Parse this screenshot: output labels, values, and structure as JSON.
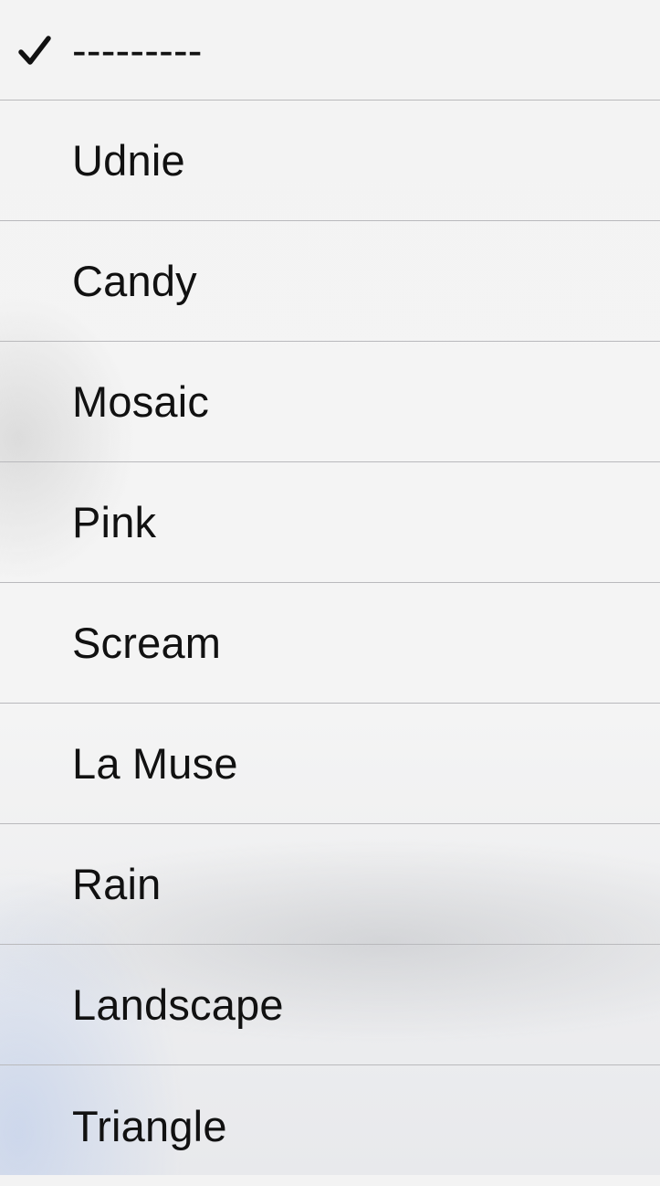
{
  "menu": {
    "selected_index": 0,
    "items": [
      {
        "label": "---------",
        "checked": true
      },
      {
        "label": "Udnie",
        "checked": false
      },
      {
        "label": "Candy",
        "checked": false
      },
      {
        "label": "Mosaic",
        "checked": false
      },
      {
        "label": "Pink",
        "checked": false
      },
      {
        "label": "Scream",
        "checked": false
      },
      {
        "label": "La Muse",
        "checked": false
      },
      {
        "label": "Rain",
        "checked": false
      },
      {
        "label": "Landscape",
        "checked": false
      },
      {
        "label": "Triangle",
        "checked": false
      }
    ]
  },
  "icons": {
    "checkmark": "checkmark-icon"
  },
  "colors": {
    "text": "#111111",
    "separator": "#b9b9bc",
    "background": "#f3f3f3"
  }
}
